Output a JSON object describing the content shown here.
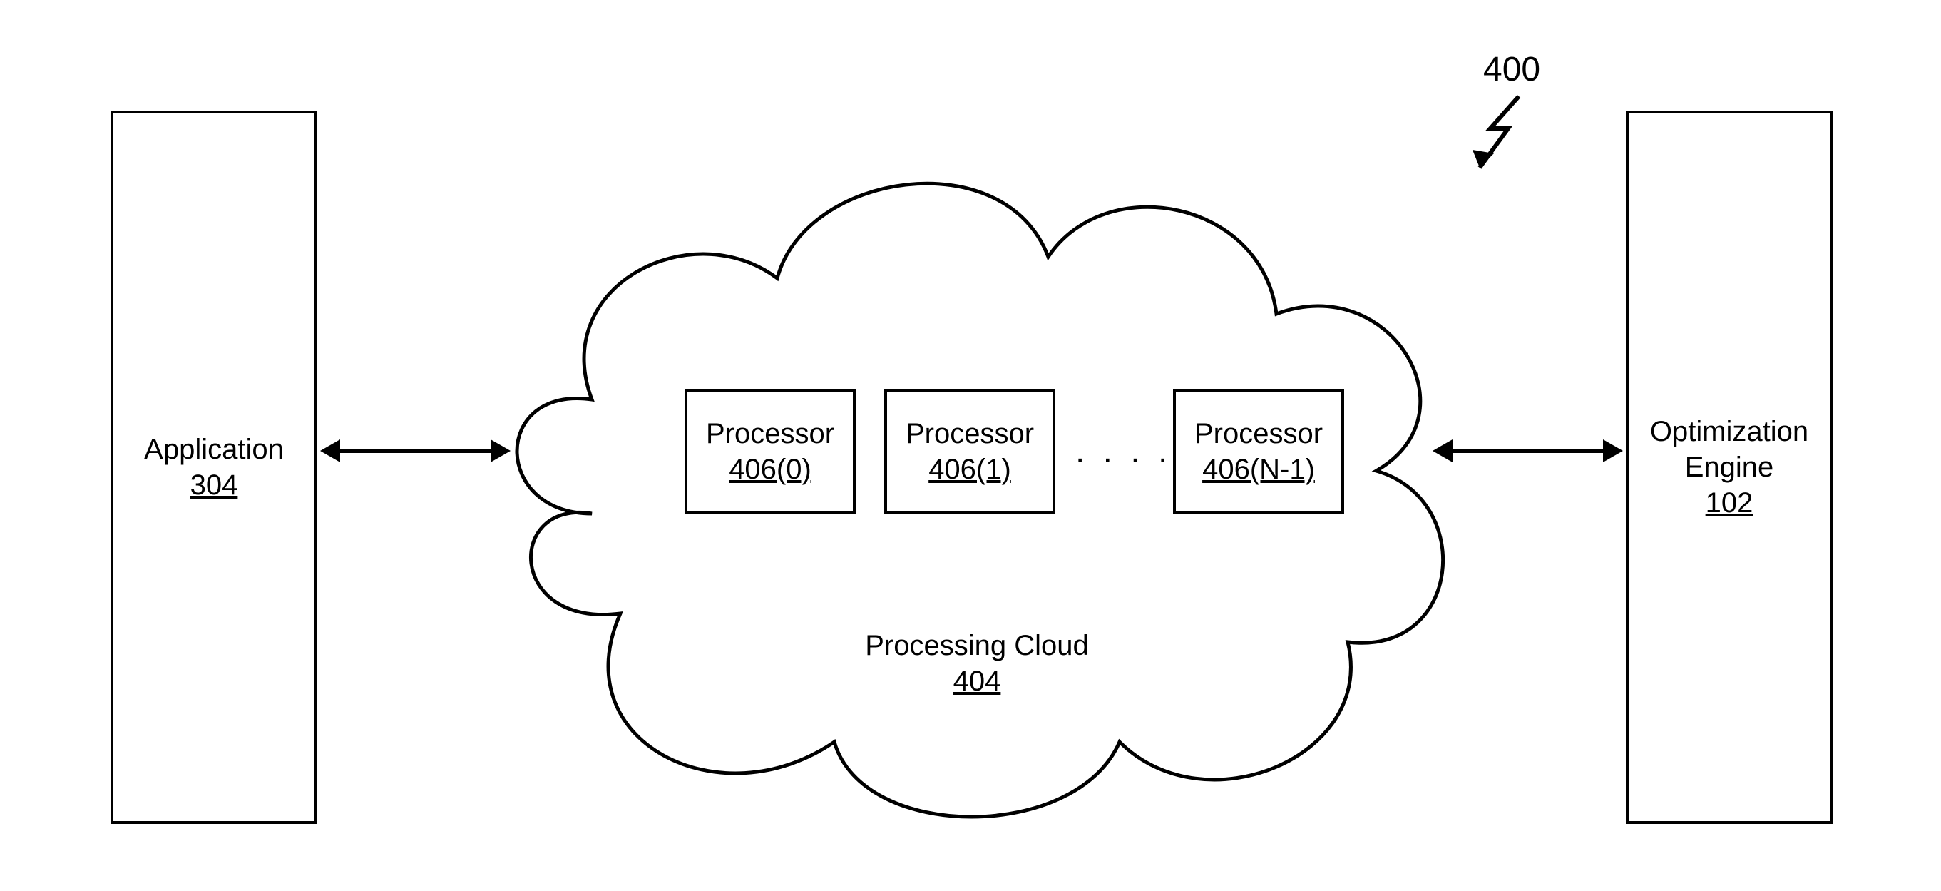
{
  "figure_ref": "400",
  "application": {
    "label": "Application",
    "ref": "304"
  },
  "optimization": {
    "label1": "Optimization",
    "label2": "Engine",
    "ref": "102"
  },
  "cloud": {
    "label": "Processing Cloud",
    "ref": "404"
  },
  "processors": {
    "label": "Processor",
    "items": [
      "406(0)",
      "406(1)",
      "406(N-1)"
    ],
    "ellipsis": ". . . ."
  }
}
